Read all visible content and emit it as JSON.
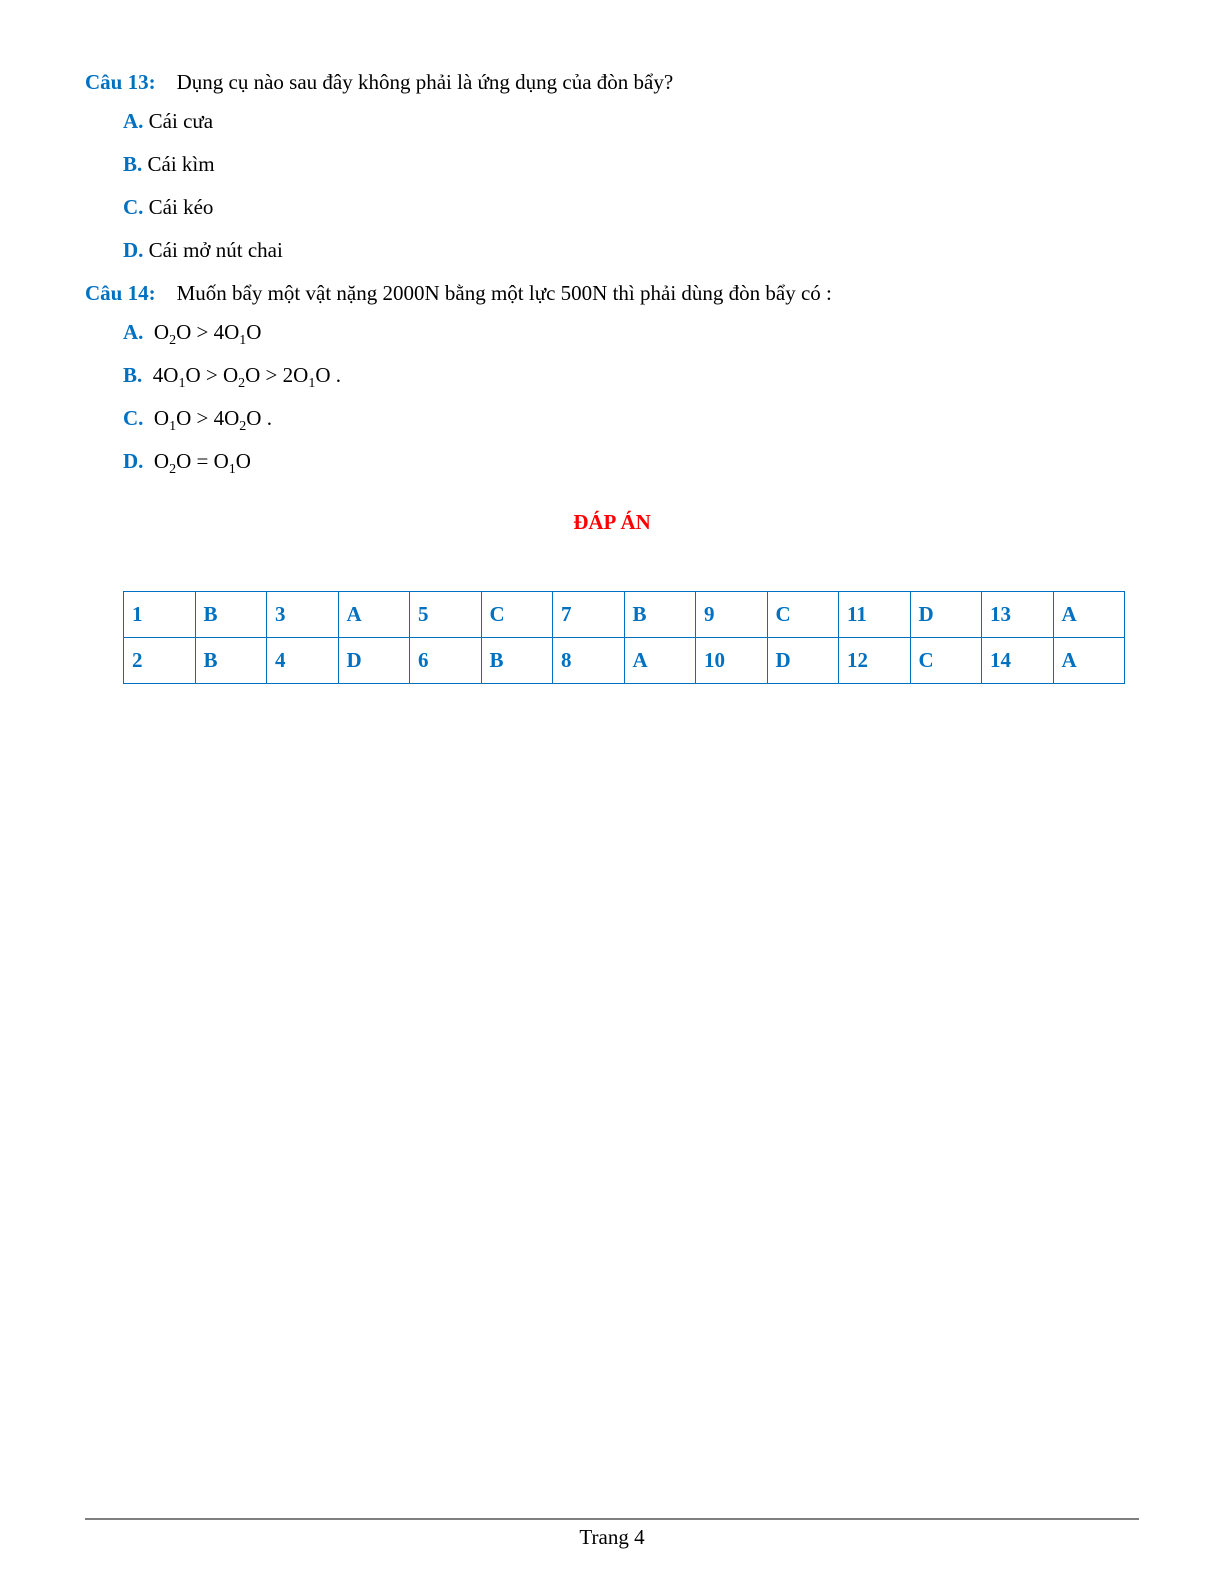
{
  "q13": {
    "label": "Câu 13:",
    "text": "Dụng cụ nào sau đây không phải là ứng dụng của đòn bẩy?",
    "options": {
      "A": "Cái cưa",
      "B": "Cái kìm",
      "C": "Cái kéo",
      "D": "Cái mở nút chai"
    }
  },
  "q14": {
    "label": "Câu 14:",
    "text": "Muốn bẩy một vật nặng 2000N bằng một lực 500N thì phải dùng đòn bẩy có :",
    "options_letters": {
      "A": "A.",
      "B": "B.",
      "C": "C.",
      "D": "D."
    }
  },
  "answer_heading": "ĐÁP ÁN",
  "answers": {
    "row1": [
      "1",
      "B",
      "3",
      "A",
      "5",
      "C",
      "7",
      "B",
      "9",
      "C",
      "11",
      "D",
      "13",
      "A"
    ],
    "row2": [
      "2",
      "B",
      "4",
      "D",
      "6",
      "B",
      "8",
      "A",
      "10",
      "D",
      "12",
      "C",
      "14",
      "A"
    ]
  },
  "footer": "Trang 4"
}
